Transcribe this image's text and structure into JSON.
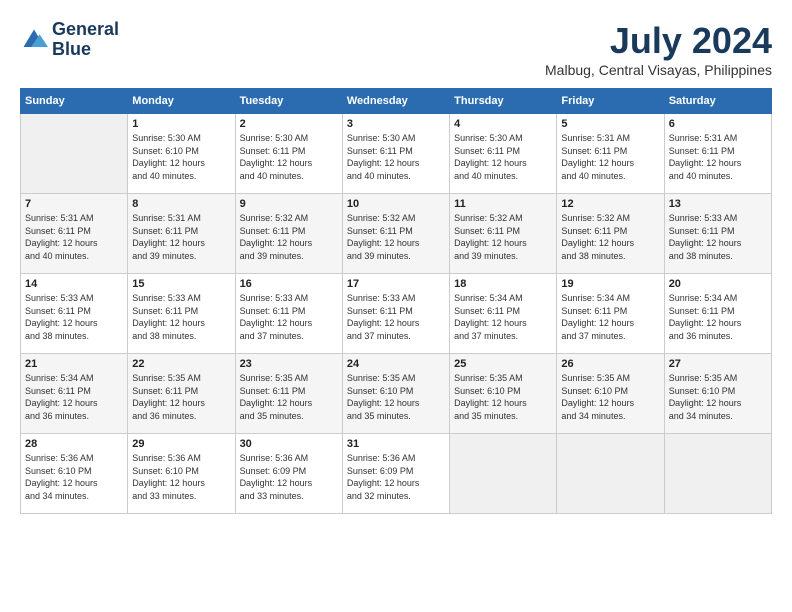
{
  "header": {
    "logo_line1": "General",
    "logo_line2": "Blue",
    "month": "July 2024",
    "location": "Malbug, Central Visayas, Philippines"
  },
  "days_of_week": [
    "Sunday",
    "Monday",
    "Tuesday",
    "Wednesday",
    "Thursday",
    "Friday",
    "Saturday"
  ],
  "weeks": [
    [
      {
        "day": "",
        "info": ""
      },
      {
        "day": "1",
        "info": "Sunrise: 5:30 AM\nSunset: 6:10 PM\nDaylight: 12 hours\nand 40 minutes."
      },
      {
        "day": "2",
        "info": "Sunrise: 5:30 AM\nSunset: 6:11 PM\nDaylight: 12 hours\nand 40 minutes."
      },
      {
        "day": "3",
        "info": "Sunrise: 5:30 AM\nSunset: 6:11 PM\nDaylight: 12 hours\nand 40 minutes."
      },
      {
        "day": "4",
        "info": "Sunrise: 5:30 AM\nSunset: 6:11 PM\nDaylight: 12 hours\nand 40 minutes."
      },
      {
        "day": "5",
        "info": "Sunrise: 5:31 AM\nSunset: 6:11 PM\nDaylight: 12 hours\nand 40 minutes."
      },
      {
        "day": "6",
        "info": "Sunrise: 5:31 AM\nSunset: 6:11 PM\nDaylight: 12 hours\nand 40 minutes."
      }
    ],
    [
      {
        "day": "7",
        "info": "Sunrise: 5:31 AM\nSunset: 6:11 PM\nDaylight: 12 hours\nand 40 minutes."
      },
      {
        "day": "8",
        "info": "Sunrise: 5:31 AM\nSunset: 6:11 PM\nDaylight: 12 hours\nand 39 minutes."
      },
      {
        "day": "9",
        "info": "Sunrise: 5:32 AM\nSunset: 6:11 PM\nDaylight: 12 hours\nand 39 minutes."
      },
      {
        "day": "10",
        "info": "Sunrise: 5:32 AM\nSunset: 6:11 PM\nDaylight: 12 hours\nand 39 minutes."
      },
      {
        "day": "11",
        "info": "Sunrise: 5:32 AM\nSunset: 6:11 PM\nDaylight: 12 hours\nand 39 minutes."
      },
      {
        "day": "12",
        "info": "Sunrise: 5:32 AM\nSunset: 6:11 PM\nDaylight: 12 hours\nand 38 minutes."
      },
      {
        "day": "13",
        "info": "Sunrise: 5:33 AM\nSunset: 6:11 PM\nDaylight: 12 hours\nand 38 minutes."
      }
    ],
    [
      {
        "day": "14",
        "info": "Sunrise: 5:33 AM\nSunset: 6:11 PM\nDaylight: 12 hours\nand 38 minutes."
      },
      {
        "day": "15",
        "info": "Sunrise: 5:33 AM\nSunset: 6:11 PM\nDaylight: 12 hours\nand 38 minutes."
      },
      {
        "day": "16",
        "info": "Sunrise: 5:33 AM\nSunset: 6:11 PM\nDaylight: 12 hours\nand 37 minutes."
      },
      {
        "day": "17",
        "info": "Sunrise: 5:33 AM\nSunset: 6:11 PM\nDaylight: 12 hours\nand 37 minutes."
      },
      {
        "day": "18",
        "info": "Sunrise: 5:34 AM\nSunset: 6:11 PM\nDaylight: 12 hours\nand 37 minutes."
      },
      {
        "day": "19",
        "info": "Sunrise: 5:34 AM\nSunset: 6:11 PM\nDaylight: 12 hours\nand 37 minutes."
      },
      {
        "day": "20",
        "info": "Sunrise: 5:34 AM\nSunset: 6:11 PM\nDaylight: 12 hours\nand 36 minutes."
      }
    ],
    [
      {
        "day": "21",
        "info": "Sunrise: 5:34 AM\nSunset: 6:11 PM\nDaylight: 12 hours\nand 36 minutes."
      },
      {
        "day": "22",
        "info": "Sunrise: 5:35 AM\nSunset: 6:11 PM\nDaylight: 12 hours\nand 36 minutes."
      },
      {
        "day": "23",
        "info": "Sunrise: 5:35 AM\nSunset: 6:11 PM\nDaylight: 12 hours\nand 35 minutes."
      },
      {
        "day": "24",
        "info": "Sunrise: 5:35 AM\nSunset: 6:10 PM\nDaylight: 12 hours\nand 35 minutes."
      },
      {
        "day": "25",
        "info": "Sunrise: 5:35 AM\nSunset: 6:10 PM\nDaylight: 12 hours\nand 35 minutes."
      },
      {
        "day": "26",
        "info": "Sunrise: 5:35 AM\nSunset: 6:10 PM\nDaylight: 12 hours\nand 34 minutes."
      },
      {
        "day": "27",
        "info": "Sunrise: 5:35 AM\nSunset: 6:10 PM\nDaylight: 12 hours\nand 34 minutes."
      }
    ],
    [
      {
        "day": "28",
        "info": "Sunrise: 5:36 AM\nSunset: 6:10 PM\nDaylight: 12 hours\nand 34 minutes."
      },
      {
        "day": "29",
        "info": "Sunrise: 5:36 AM\nSunset: 6:10 PM\nDaylight: 12 hours\nand 33 minutes."
      },
      {
        "day": "30",
        "info": "Sunrise: 5:36 AM\nSunset: 6:09 PM\nDaylight: 12 hours\nand 33 minutes."
      },
      {
        "day": "31",
        "info": "Sunrise: 5:36 AM\nSunset: 6:09 PM\nDaylight: 12 hours\nand 32 minutes."
      },
      {
        "day": "",
        "info": ""
      },
      {
        "day": "",
        "info": ""
      },
      {
        "day": "",
        "info": ""
      }
    ]
  ]
}
